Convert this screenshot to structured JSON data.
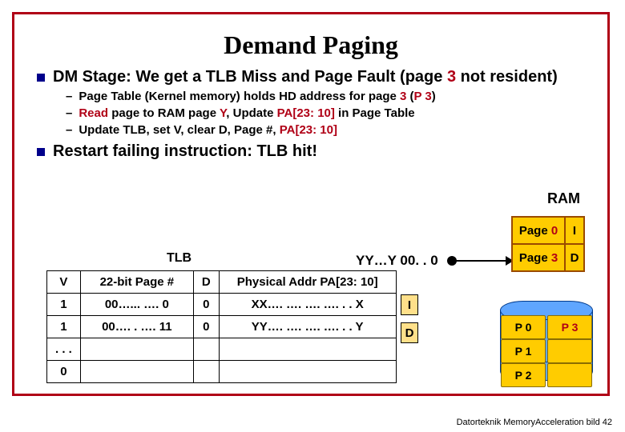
{
  "title": "Demand Paging",
  "bullets": [
    {
      "pre": "DM Stage: We get a TLB Miss and Page Fault (page ",
      "red": "3",
      "post": " not resident)",
      "subs": [
        {
          "pre": "Page Table (Kernel memory) holds HD address for page ",
          "r1": "3",
          "mid": " (",
          "r2": "P 3",
          "post": ")"
        },
        {
          "r1": "Read",
          "mid1": " page to RAM page ",
          "r2": "Y",
          "mid2": ", Update ",
          "r3": "PA[23: 10]",
          "post": " in Page Table"
        },
        {
          "pre": "Update TLB, set V, clear D, Page #, ",
          "r1": "PA[23: 10]"
        }
      ]
    },
    {
      "pre": "Restart failing instruction: TLB hit!"
    }
  ],
  "tlb": {
    "title": "TLB",
    "headers": [
      "V",
      "22-bit Page #",
      "D",
      "Physical Addr PA[23: 10]"
    ],
    "rows": [
      {
        "cells": [
          "1",
          "00…... …. 0",
          "0",
          "XX…. …. …. …. . . X"
        ],
        "flag": "I"
      },
      {
        "cells": [
          "1",
          "00…. . …. 11",
          "0",
          "YY…. …. …. …. . . Y"
        ],
        "flag": "D"
      },
      {
        "cells": [
          ". . .",
          "",
          "",
          ""
        ]
      },
      {
        "cells": [
          "0",
          "",
          "",
          ""
        ]
      }
    ]
  },
  "addr_label": "YY…Y 00. . 0",
  "ram": {
    "label": "RAM",
    "rows": [
      {
        "c1pre": "Page ",
        "c1red": "0",
        "c2": "I"
      },
      {
        "c1pre": "Page ",
        "c1red": "3",
        "c2": "D"
      }
    ]
  },
  "disk": {
    "cells": [
      {
        "t": "P 0",
        "red": false
      },
      {
        "t": "P 3",
        "red": true
      },
      {
        "t": "P 1",
        "red": false
      },
      {
        "t": "",
        "red": false
      },
      {
        "t": "P 2",
        "red": false
      },
      {
        "t": "",
        "red": false
      }
    ]
  },
  "footer": "Datorteknik MemoryAcceleration bild 42",
  "chart_data": {
    "type": "table",
    "title": "Demand Paging — TLB / RAM / Disk state",
    "tlb": [
      {
        "V": 1,
        "page_num_22b": "00…0 (binary 0)",
        "D": 0,
        "PA_23_10": "XX…X",
        "flag": "I"
      },
      {
        "V": 1,
        "page_num_22b": "00…11 (binary 3)",
        "D": 0,
        "PA_23_10": "YY…Y",
        "flag": "D"
      },
      {
        "V": "...",
        "page_num_22b": "",
        "D": "",
        "PA_23_10": ""
      },
      {
        "V": 0,
        "page_num_22b": "",
        "D": "",
        "PA_23_10": ""
      }
    ],
    "ram_frames": [
      {
        "frame_phys_addr": "YY…Y00..0 / Page 0",
        "contents": "Page 0",
        "flag": "I"
      },
      {
        "frame_phys_addr": "Page 3",
        "contents": "Page 3",
        "flag": "D"
      }
    ],
    "disk_pages": [
      "P0",
      "P1",
      "P2",
      "P3"
    ],
    "faulting_page": 3,
    "faulting_disk_addr": "P3"
  }
}
